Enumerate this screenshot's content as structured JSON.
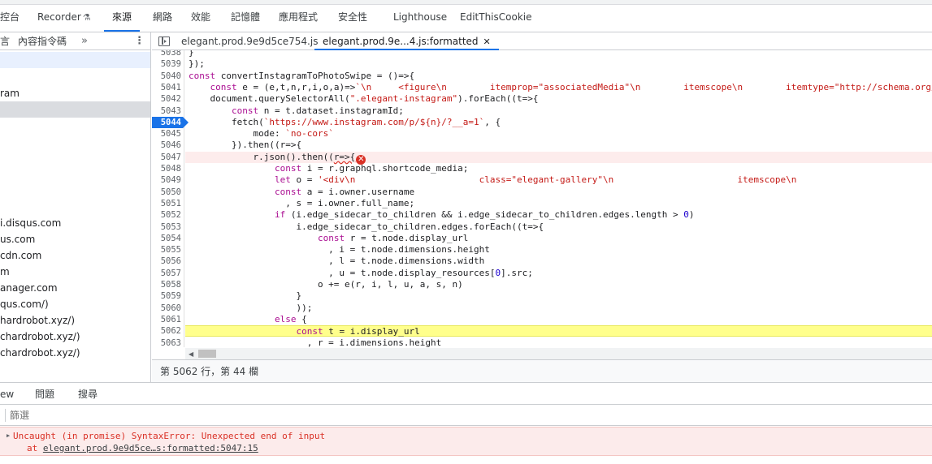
{
  "top_tabs": [
    {
      "label": "控台",
      "active": false
    },
    {
      "label": "Recorder",
      "active": false
    },
    {
      "label": "來源",
      "active": true
    },
    {
      "label": "網路",
      "active": false
    },
    {
      "label": "效能",
      "active": false
    },
    {
      "label": "記憶體",
      "active": false
    },
    {
      "label": "應用程式",
      "active": false
    },
    {
      "label": "安全性",
      "active": false
    },
    {
      "label": "Lighthouse",
      "active": false
    },
    {
      "label": "EditThisCookie",
      "active": false
    }
  ],
  "left_panel": {
    "tab_label": "內容指令碼",
    "more_label": "»",
    "kebab_label": "⋮",
    "prefix_label": "言",
    "tree": [
      "ram",
      "i.disqus.com",
      "us.com",
      "cdn.com",
      "m",
      "anager.com",
      "qus.com/)",
      "hardrobot.xyz/)",
      "chardrobot.xyz/)",
      "chardrobot.xyz/)"
    ]
  },
  "editor_tabs": [
    {
      "label": "elegant.prod.9e9d5ce754.js",
      "active": false
    },
    {
      "label": "elegant.prod.9e...4.js:formatted",
      "active": true,
      "close": "✕"
    }
  ],
  "code": {
    "first_partial_line": "5038",
    "lines": [
      {
        "n": "5039",
        "text": "});"
      },
      {
        "n": "5040",
        "text": "const convertInstagramToPhotoSwipe = ()=>{"
      },
      {
        "n": "5041",
        "text": "    const e = (e,t,n,r,i,o,a)=>`\\n     <figure\\n        itemprop=\"associatedMedia\"\\n        itemscope\\n        itemtype=\"http://schema.org/"
      },
      {
        "n": "5042",
        "text": "    document.querySelectorAll(\".elegant-instagram\").forEach((t=>{"
      },
      {
        "n": "5043",
        "text": "        const n = t.dataset.instagramId;"
      },
      {
        "n": "5044",
        "text": "        fetch(`https://www.instagram.com/p/${n}/?__a=1`, {"
      },
      {
        "n": "5045",
        "text": "            mode: `no-cors`"
      },
      {
        "n": "5046",
        "text": "        }).then((r=>{"
      },
      {
        "n": "5047",
        "text": "            r.json().then((r=>{"
      },
      {
        "n": "5048",
        "text": "                const i = r.graphql.shortcode_media;"
      },
      {
        "n": "5049",
        "text": "                let o = '<div\\n                       class=\"elegant-gallery\"\\n                       itemscope\\n"
      },
      {
        "n": "5050",
        "text": "                const a = i.owner.username"
      },
      {
        "n": "5051",
        "text": "                  , s = i.owner.full_name;"
      },
      {
        "n": "5052",
        "text": "                if (i.edge_sidecar_to_children && i.edge_sidecar_to_children.edges.length > 0)"
      },
      {
        "n": "5053",
        "text": "                    i.edge_sidecar_to_children.edges.forEach((t=>{"
      },
      {
        "n": "5054",
        "text": "                        const r = t.node.display_url"
      },
      {
        "n": "5055",
        "text": "                          , i = t.node.dimensions.height"
      },
      {
        "n": "5056",
        "text": "                          , l = t.node.dimensions.width"
      },
      {
        "n": "5057",
        "text": "                          , u = t.node.display_resources[0].src;"
      },
      {
        "n": "5058",
        "text": "                        o += e(r, i, l, u, a, s, n)"
      },
      {
        "n": "5059",
        "text": "                    }"
      },
      {
        "n": "5060",
        "text": "                    ));"
      },
      {
        "n": "5061",
        "text": "                else {"
      },
      {
        "n": "5062",
        "text": "                    const t = i.display_url"
      },
      {
        "n": "5063",
        "text": "                      , r = i.dimensions.height"
      }
    ],
    "last_line": "5064",
    "breakpoint_line": "5044",
    "error_line": "5047",
    "highlight_line": "5062",
    "error_badge": "✕"
  },
  "status_bar": "第 5062 行，第 44 欄",
  "drawer_tabs": [
    "ew",
    "問題",
    "搜尋"
  ],
  "filter": {
    "placeholder": "篩選"
  },
  "console_error": {
    "message": "Uncaught (in promise) SyntaxError: Unexpected end of input",
    "at_prefix": "at ",
    "location": "elegant.prod.9e9d5ce…s:formatted:5047:15"
  },
  "colors": {
    "accent": "#1a73e8",
    "error": "#d93025",
    "highlight": "#ffff8c",
    "error_bg": "#fcebeb"
  }
}
